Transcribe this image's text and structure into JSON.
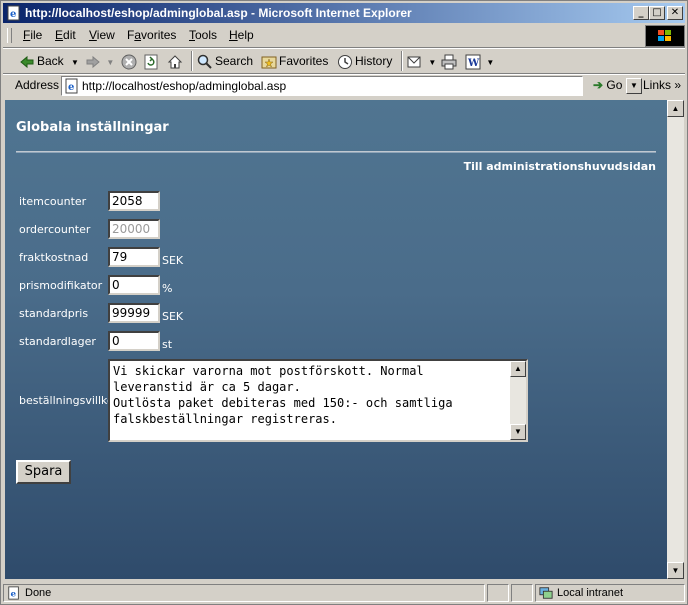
{
  "window": {
    "title": "http://localhost/eshop/adminglobal.asp - Microsoft Internet Explorer"
  },
  "menu": {
    "items": [
      {
        "pre": "",
        "u": "F",
        "post": "ile"
      },
      {
        "pre": "",
        "u": "E",
        "post": "dit"
      },
      {
        "pre": "",
        "u": "V",
        "post": "iew"
      },
      {
        "pre": "F",
        "u": "a",
        "post": "vorites"
      },
      {
        "pre": "",
        "u": "T",
        "post": "ools"
      },
      {
        "pre": "",
        "u": "H",
        "post": "elp"
      }
    ]
  },
  "toolbar": {
    "back_label": "Back",
    "search_label": "Search",
    "favorites_label": "Favorites",
    "history_label": "History"
  },
  "address": {
    "label": "Address",
    "url": "http://localhost/eshop/adminglobal.asp",
    "go_label": "Go",
    "links_label": "Links"
  },
  "page": {
    "title": "Globala inställningar",
    "admin_link": "Till administrationshuvudsidan",
    "fields": [
      {
        "label": "itemcounter",
        "value": "2058",
        "unit": "",
        "disabled": false
      },
      {
        "label": "ordercounter",
        "value": "20000",
        "unit": "",
        "disabled": true
      },
      {
        "label": "fraktkostnad",
        "value": "79",
        "unit": "SEK",
        "disabled": false
      },
      {
        "label": "prismodifikator",
        "value": "0",
        "unit": "%",
        "disabled": false
      },
      {
        "label": "standardpris",
        "value": "99999",
        "unit": "SEK",
        "disabled": false
      },
      {
        "label": "standardlager",
        "value": "0",
        "unit": "st",
        "disabled": false
      }
    ],
    "terms_label": "beställningsvillkor",
    "terms_text": "Vi skickar varorna mot postförskott. Normal\nleveranstid är ca 5 dagar.\nOutlösta paket debiteras med 150:- och samtliga\nfalskbeställningar registreras.",
    "save_label": "Spara"
  },
  "status": {
    "text": "Done",
    "zone": "Local intranet"
  }
}
